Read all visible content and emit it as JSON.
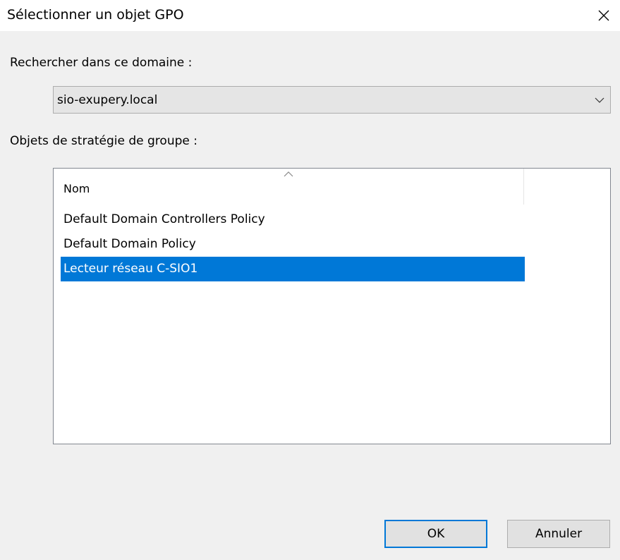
{
  "window": {
    "title": "Sélectionner un objet GPO",
    "close_icon": "close-icon"
  },
  "domain": {
    "label": "Rechercher dans ce domaine :",
    "selected_value": "sio-exupery.local",
    "dropdown_icon": "chevron-down-icon"
  },
  "gpo_list": {
    "label": "Objets de stratégie de groupe :",
    "columns": [
      {
        "label": "Nom",
        "sort": "ascending"
      }
    ],
    "items": [
      {
        "name": "Default Domain Controllers Policy",
        "selected": false
      },
      {
        "name": "Default Domain Policy",
        "selected": false
      },
      {
        "name": "Lecteur réseau C-SIO1",
        "selected": true
      }
    ]
  },
  "buttons": {
    "ok_label": "OK",
    "cancel_label": "Annuler"
  },
  "colors": {
    "selection": "#0078d7",
    "dialog_bg": "#f0f0f0",
    "default_button_border": "#0078d7"
  }
}
